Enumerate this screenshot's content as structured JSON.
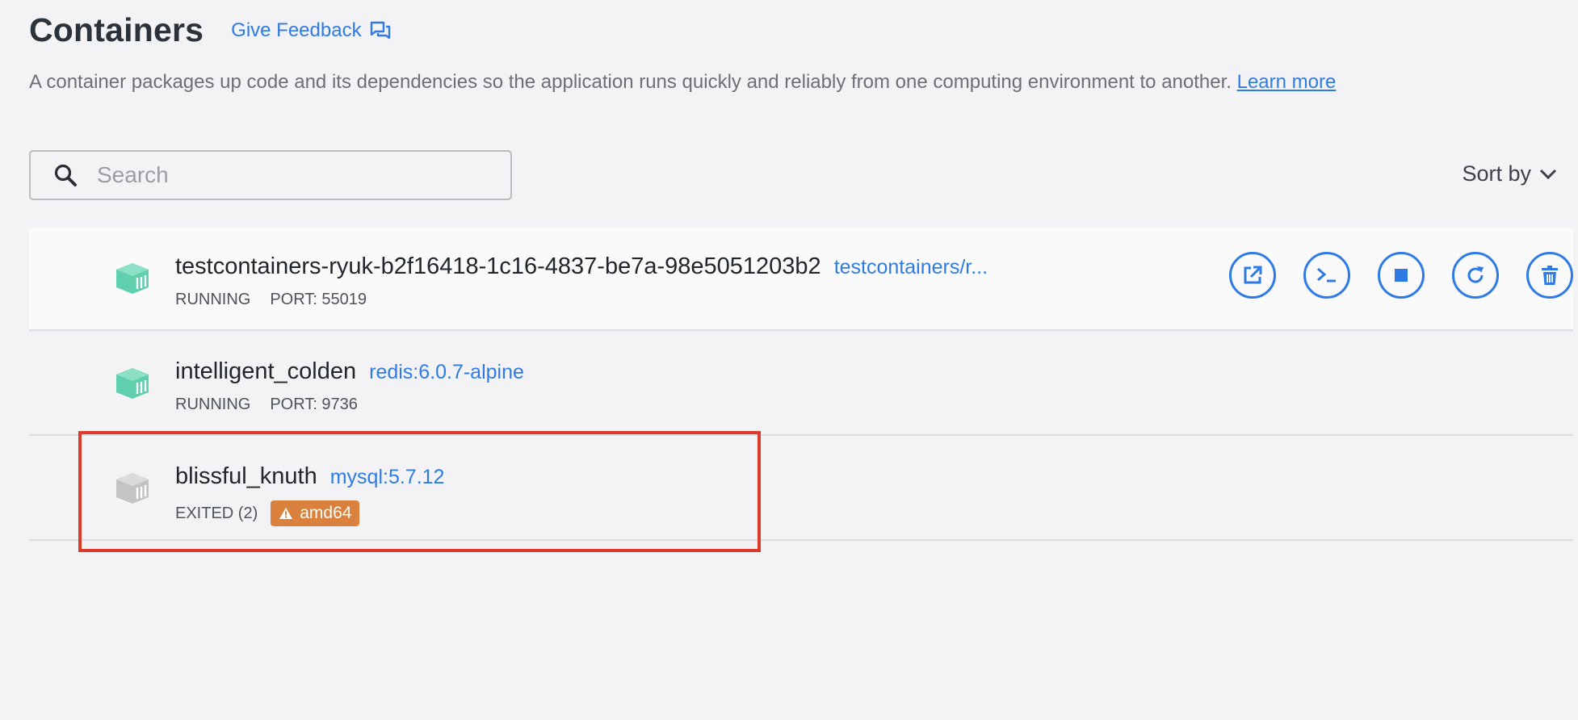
{
  "header": {
    "title": "Containers",
    "feedback_label": "Give Feedback"
  },
  "description": {
    "text": "A container packages up code and its dependencies so the application runs quickly and reliably from one computing environment to another. ",
    "link": "Learn more"
  },
  "search": {
    "placeholder": "Search",
    "value": ""
  },
  "sort": {
    "label": "Sort by"
  },
  "containers": [
    {
      "name": "testcontainers-ryuk-b2f16418-1c16-4837-be7a-98e5051203b2",
      "image": "testcontainers/r...",
      "status": "RUNNING",
      "port": "PORT: 55019",
      "icon_color": "#5fcfad"
    },
    {
      "name": "intelligent_colden",
      "image": "redis:6.0.7-alpine",
      "status": "RUNNING",
      "port": "PORT: 9736",
      "icon_color": "#5fcfad"
    },
    {
      "name": "blissful_knuth",
      "image": "mysql:5.7.12",
      "status": "EXITED (2)",
      "badge": "amd64",
      "icon_color": "#c4c4c6"
    }
  ],
  "actions": [
    "open-in-browser",
    "cli",
    "stop",
    "restart",
    "delete"
  ],
  "colors": {
    "accent": "#2f7be5",
    "running": "#5fcfad",
    "exited": "#c4c4c6",
    "warning_badge": "#d9813d",
    "highlight": "#dd3b2a"
  }
}
